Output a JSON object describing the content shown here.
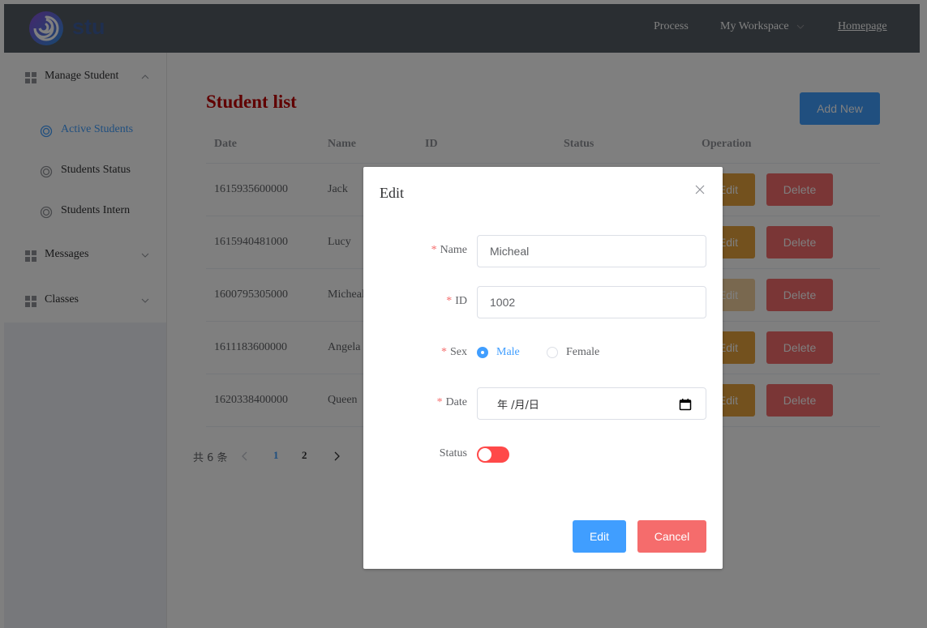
{
  "header": {
    "logo_text": "stu",
    "nav": {
      "process": "Process",
      "workspace": "My Workspace",
      "homepage": "Homepage"
    }
  },
  "sidebar": {
    "items": [
      {
        "label": "Manage Student",
        "icon": "grid-icon",
        "expanded": true
      },
      {
        "label": "Messages",
        "icon": "grid-icon",
        "expanded": false
      },
      {
        "label": "Classes",
        "icon": "grid-icon",
        "expanded": false
      }
    ],
    "sub_items": [
      {
        "label": "Active Students",
        "icon": "ring-icon",
        "active": true
      },
      {
        "label": "Students Status",
        "icon": "ring-icon",
        "active": false
      },
      {
        "label": "Students Intern",
        "icon": "ring-icon",
        "active": false
      }
    ]
  },
  "main": {
    "title": "Student list",
    "add_button": "Add New",
    "table": {
      "columns": [
        "Date",
        "Name",
        "ID",
        "Status",
        "Operation"
      ],
      "rows": [
        {
          "date": "1615935600000",
          "name": "Jack"
        },
        {
          "date": "1615940481000",
          "name": "Lucy"
        },
        {
          "date": "1600795305000",
          "name": "Micheal"
        },
        {
          "date": "1611183600000",
          "name": "Angela"
        },
        {
          "date": "1620338400000",
          "name": "Queen"
        }
      ],
      "edit_label": "Edit",
      "delete_label": "Delete"
    },
    "pagination": {
      "total": "共 6 条",
      "pages": [
        "1",
        "2"
      ],
      "current": "1"
    }
  },
  "dialog": {
    "title": "Edit",
    "fields": {
      "name_label": "Name",
      "name_value": "Micheal",
      "id_label": "ID",
      "id_value": "1002",
      "sex_label": "Sex",
      "sex_options": [
        "Male",
        "Female"
      ],
      "sex_selected": "Male",
      "date_label": "Date",
      "date_placeholder": "年 /月/日",
      "status_label": "Status",
      "status_on": false
    },
    "required_mark": "*",
    "edit_button": "Edit",
    "cancel_button": "Cancel"
  },
  "colors": {
    "header_bg": "#545c64",
    "primary": "#409eff",
    "warning": "#e6a23c",
    "danger": "#f56c6c",
    "title_red": "#c00000",
    "switch_off": "#ff4949"
  }
}
